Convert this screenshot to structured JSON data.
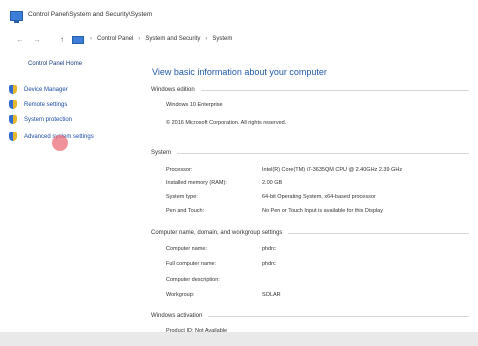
{
  "window": {
    "title": "Control Panel\\System and Security\\System"
  },
  "address": {
    "back": "←",
    "forward": "→",
    "up": "↑",
    "crumbs": [
      "Control Panel",
      "System and Security",
      "System"
    ],
    "separator": "›"
  },
  "sidebar": {
    "heading": "Control Panel Home",
    "items": [
      {
        "label": "Device Manager",
        "icon": "shield-icon"
      },
      {
        "label": "Remote settings",
        "icon": "shield-icon"
      },
      {
        "label": "System protection",
        "icon": "shield-icon"
      },
      {
        "label": "Advanced system settings",
        "icon": "shield-icon"
      }
    ]
  },
  "main": {
    "title": "View basic information about your computer",
    "edition": {
      "heading": "Windows edition",
      "name": "Windows 10 Enterprise",
      "copyright": "© 2016 Microsoft Corporation. All rights reserved."
    },
    "system": {
      "heading": "System",
      "rows": [
        {
          "label": "Processor:",
          "value": "Intel(R) Core(TM) i7-3635QM CPU @ 2.40GHz   2.39 GHz"
        },
        {
          "label": "Installed memory (RAM):",
          "value": "2.00 GB"
        },
        {
          "label": "System type:",
          "value": "64-bit Operating System, x64-based processor"
        },
        {
          "label": "Pen and Touch:",
          "value": "No Pen or Touch Input is available for this Display"
        }
      ]
    },
    "naming": {
      "heading": "Computer name, domain, and workgroup settings",
      "rows": [
        {
          "label": "Computer name:",
          "value": "phdrc"
        },
        {
          "label": "Full computer name:",
          "value": "phdrc"
        },
        {
          "label": "Computer description:",
          "value": ""
        },
        {
          "label": "Workgroup:",
          "value": "SOLAR"
        }
      ]
    },
    "activation": {
      "heading": "Windows activation",
      "status": "Product ID: Not Available"
    }
  },
  "colors": {
    "link": "#1a4da8",
    "title": "#1f5aa8",
    "accent": "#3b7dd8"
  }
}
